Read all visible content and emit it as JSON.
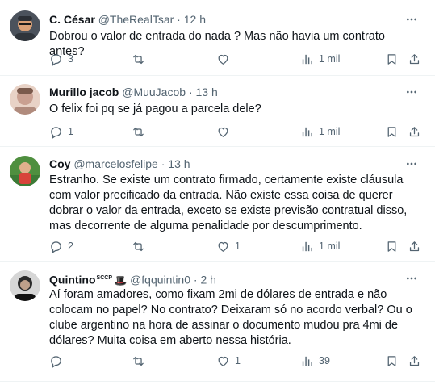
{
  "tweets": [
    {
      "name": "C. César",
      "badge": "",
      "handle": "@TheRealTsar",
      "time": "12 h",
      "text": "Dobrou o valor de entrada do nada ? Mas não havia um contrato antes?",
      "replies": "3",
      "retweets": "",
      "likes": "",
      "views": "1 mil",
      "avatar_colors": [
        "#3a3f48",
        "#d9a077"
      ]
    },
    {
      "name": "Murillo jacob",
      "badge": "",
      "handle": "@MuuJacob",
      "time": "13 h",
      "text": "O felix foi pq se já pagou a parcela dele?",
      "replies": "1",
      "retweets": "",
      "likes": "",
      "views": "1 mil",
      "avatar_colors": [
        "#c9a091",
        "#e8d2c6"
      ]
    },
    {
      "name": "Coy",
      "badge": "",
      "handle": "@marcelosfelipe",
      "time": "13 h",
      "text": "Estranho. Se existe um contrato firmado, certamente existe cláusula com valor precificado da entrada. Não existe essa coisa de querer dobrar o valor da entrada, exceto se existe previsão contratual disso, mas decorrente de alguma penalidade por descumprimento.",
      "replies": "2",
      "retweets": "",
      "likes": "1",
      "views": "1 mil",
      "avatar_colors": [
        "#3c7a36",
        "#d8433a"
      ]
    },
    {
      "name": "Quintino",
      "badge": "SCCP",
      "handle": "@fqquintin0",
      "time": "2 h",
      "text": "Aí foram amadores, como fixam 2mi de dólares de entrada e não colocam no papel? No contrato? Deixaram só no acordo verbal? Ou o clube argentino na hora de assinar o documento mudou pra 4mi de dólares? Muita coisa em aberto nessa história.",
      "replies": "",
      "retweets": "",
      "likes": "1",
      "views": "39",
      "avatar_colors": [
        "#2a2a2a",
        "#cfcfcf"
      ]
    }
  ],
  "separator": "·",
  "colors": {
    "text": "#0f1419",
    "secondary": "#536471",
    "border": "#eff3f4"
  }
}
